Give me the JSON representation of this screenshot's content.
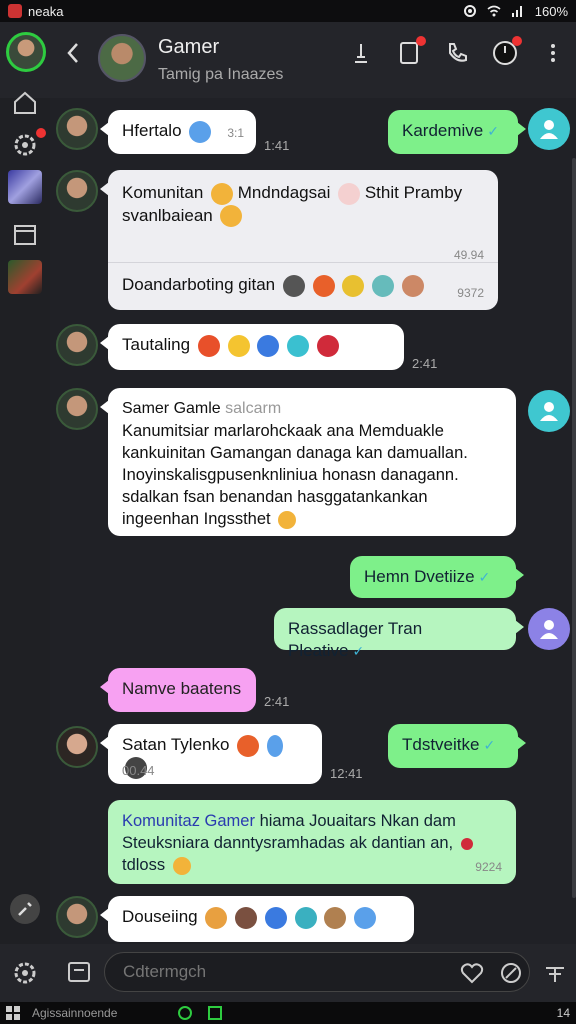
{
  "status_bar": {
    "app_name": "neaka",
    "battery": "160%"
  },
  "header": {
    "title": "Gamer",
    "subtitle": "Tamig pa Inaazes",
    "back_icon": "chevron-left-icon"
  },
  "messages": {
    "m1": {
      "text": "Hfertalo",
      "time": "3:1",
      "outer_time": "1:41"
    },
    "m2": {
      "text": "Kardemive"
    },
    "m3": {
      "line1": "Komunitan",
      "line1b": "Mndndagsai",
      "line1c": "Sthit Pramby",
      "line2": "svanlbaiean",
      "time1": "49.94",
      "line3": "Doandarboting gitan",
      "time2": "9372"
    },
    "m4": {
      "text": "Tautaling",
      "outer_time": "2:41"
    },
    "m5": {
      "sender": "Samer Gamle",
      "sender_tag": "salcarm",
      "lines": [
        "Kanumitsiar marlarohckaak ana Memduakle",
        "kankuinitan Gamangan danaga kan damuallan.",
        "Inoyinskalisgpusenknliniua honasn danagann.",
        "sdalkan fsan benandan hasggatankankan",
        "ingeenhan Ingssthet"
      ]
    },
    "m6": {
      "text": "Hemn Dvetiize"
    },
    "m7": {
      "text": "Rassadlager Tran Pleative"
    },
    "m8": {
      "text": "Namve baatens",
      "outer_time": "2:41"
    },
    "m9": {
      "text": "Satan Tylenko",
      "time": "00.44",
      "outer_time": "12:41"
    },
    "m10": {
      "text": "Tdstveitke"
    },
    "m11": {
      "link": "Komunitaz Gamer",
      "line1": "hiama Jouaitars Nkan dam",
      "line2": "Steuksniara danntysramhadas ak dantian an,",
      "line3": "tdloss",
      "time": "9224"
    },
    "m12": {
      "text": "Douseiing"
    }
  },
  "composer": {
    "placeholder": "Cdtermgch"
  },
  "taskbar": {
    "label": "Agissainnoende",
    "time": "14"
  },
  "colors": {
    "green_bubble": "#7ef08a",
    "pink_bubble": "#f7a1f2",
    "accent_teal": "#3fc7d0"
  }
}
